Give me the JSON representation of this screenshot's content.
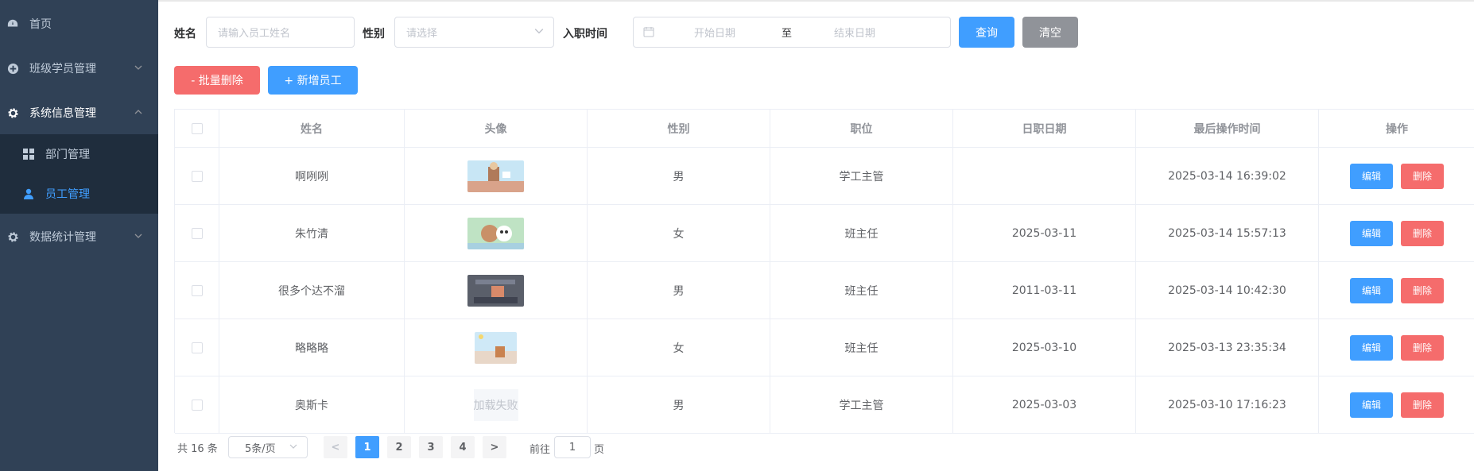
{
  "sidebar": {
    "items": [
      {
        "label": "首页",
        "icon": "dashboard-icon"
      },
      {
        "label": "班级学员管理",
        "icon": "plus-circle-icon"
      },
      {
        "label": "系统信息管理",
        "icon": "gear-icon"
      },
      {
        "label": "数据统计管理",
        "icon": "gear-icon"
      }
    ],
    "subitems": [
      {
        "label": "部门管理",
        "icon": "grid-icon"
      },
      {
        "label": "员工管理",
        "icon": "user-icon"
      }
    ],
    "active_color": "#409eff",
    "bg_color": "#304156"
  },
  "search": {
    "name_label": "姓名",
    "name_placeholder": "请输入员工姓名",
    "gender_label": "性别",
    "gender_placeholder": "请选择",
    "date_label": "入职时间",
    "start_placeholder": "开始日期",
    "separator": "至",
    "end_placeholder": "结束日期",
    "query_btn": "查询",
    "clear_btn": "清空"
  },
  "actions": {
    "batch_delete": "- 批量删除",
    "add_employee": "+ 新增员工"
  },
  "table": {
    "headers": [
      "姓名",
      "头像",
      "性别",
      "职位",
      "日职日期",
      "最后操作时间",
      "操作"
    ],
    "rows": [
      {
        "name": "啊咧咧",
        "gender": "男",
        "job": "学工主管",
        "entry": "",
        "updated": "2025-03-14 16:39:02"
      },
      {
        "name": "朱竹清",
        "gender": "女",
        "job": "班主任",
        "entry": "2025-03-11",
        "updated": "2025-03-14 15:57:13"
      },
      {
        "name": "很多个达不溜",
        "gender": "男",
        "job": "班主任",
        "entry": "2011-03-11",
        "updated": "2025-03-14 10:42:30"
      },
      {
        "name": "略略略",
        "gender": "女",
        "job": "班主任",
        "entry": "2025-03-10",
        "updated": "2025-03-13 23:35:34"
      },
      {
        "name": "奥斯卡",
        "gender": "男",
        "job": "学工主管",
        "entry": "2025-03-03",
        "updated": "2025-03-10 17:16:23"
      }
    ],
    "avatar_failed_text": "加载失败",
    "edit_label": "编辑",
    "delete_label": "删除"
  },
  "pagination": {
    "total": "共 16 条",
    "page_size": "5条/页",
    "pages": [
      "1",
      "2",
      "3",
      "4"
    ],
    "prev": "<",
    "next": ">",
    "goto_label": "前往",
    "goto_value": "1",
    "page_suffix": "页"
  }
}
